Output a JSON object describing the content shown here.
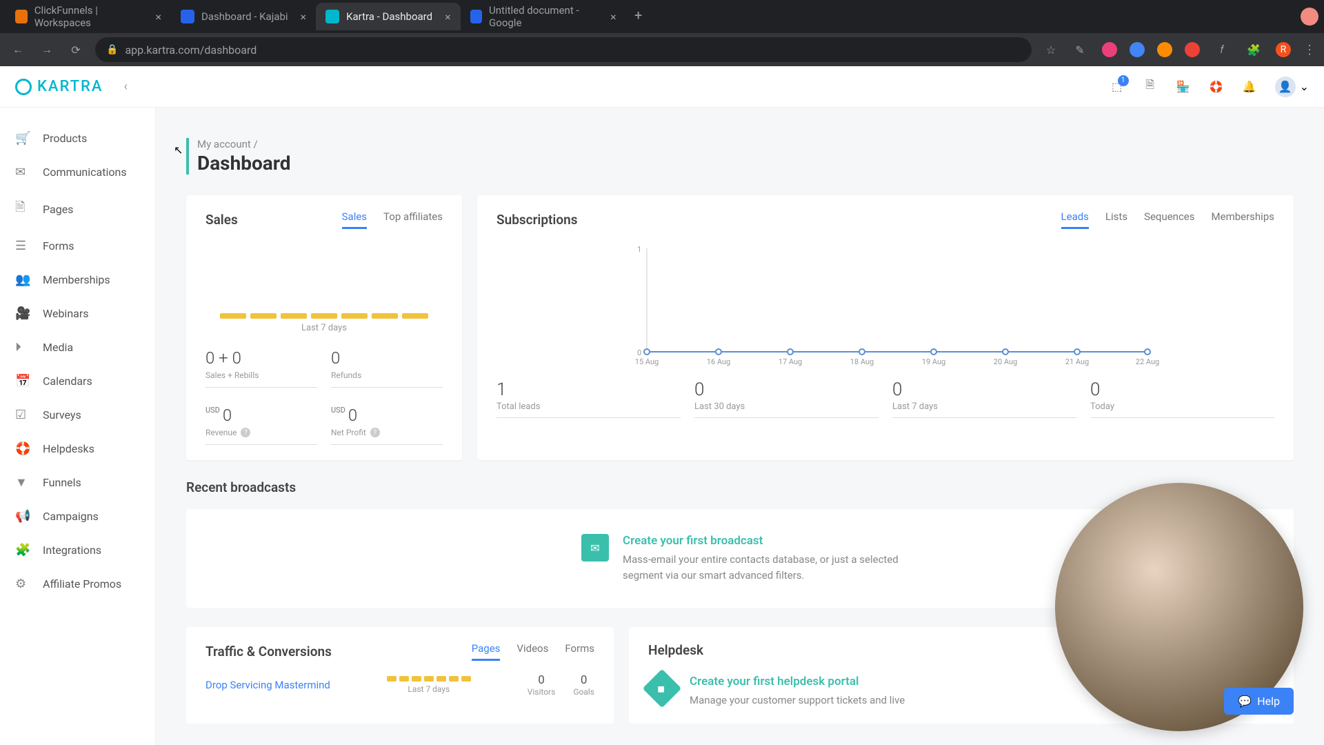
{
  "browser": {
    "tabs": [
      {
        "title": "ClickFunnels | Workspaces",
        "favBg": "#e8710a"
      },
      {
        "title": "Dashboard - Kajabi",
        "favBg": "#2563eb"
      },
      {
        "title": "Kartra - Dashboard",
        "favBg": "#00b7cd",
        "active": true
      },
      {
        "title": "Untitled document - Google",
        "favBg": "#2563eb"
      }
    ],
    "url": "app.kartra.com/dashboard"
  },
  "logo": "KARTRA",
  "nav": [
    {
      "icon": "🛒",
      "label": "Products"
    },
    {
      "icon": "✉",
      "label": "Communications"
    },
    {
      "icon": "🗎",
      "label": "Pages"
    },
    {
      "icon": "☰",
      "label": "Forms"
    },
    {
      "icon": "👥",
      "label": "Memberships"
    },
    {
      "icon": "🎥",
      "label": "Webinars"
    },
    {
      "icon": "⏵",
      "label": "Media"
    },
    {
      "icon": "📅",
      "label": "Calendars"
    },
    {
      "icon": "☑",
      "label": "Surveys"
    },
    {
      "icon": "🛟",
      "label": "Helpdesks"
    },
    {
      "icon": "▼",
      "label": "Funnels"
    },
    {
      "icon": "📢",
      "label": "Campaigns"
    },
    {
      "icon": "🧩",
      "label": "Integrations"
    },
    {
      "icon": "⚙",
      "label": "Affiliate Promos"
    }
  ],
  "breadcrumb": {
    "parent": "My account /",
    "title": "Dashboard"
  },
  "sales": {
    "title": "Sales",
    "tabs": [
      "Sales",
      "Top affiliates"
    ],
    "period": "Last 7 days",
    "stats": [
      {
        "value": "0 + 0",
        "label": "Sales + Rebills"
      },
      {
        "value": "0",
        "label": "Refunds"
      },
      {
        "currency": "USD",
        "value": "0",
        "label": "Revenue",
        "help": true
      },
      {
        "currency": "USD",
        "value": "0",
        "label": "Net Profit",
        "help": true
      }
    ]
  },
  "subs": {
    "title": "Subscriptions",
    "tabs": [
      "Leads",
      "Lists",
      "Sequences",
      "Memberships"
    ],
    "stats": [
      {
        "value": "1",
        "label": "Total leads"
      },
      {
        "value": "0",
        "label": "Last 30 days"
      },
      {
        "value": "0",
        "label": "Last 7 days"
      },
      {
        "value": "0",
        "label": "Today"
      }
    ]
  },
  "chart_data": {
    "type": "line",
    "categories": [
      "15 Aug",
      "16 Aug",
      "17 Aug",
      "18 Aug",
      "19 Aug",
      "20 Aug",
      "21 Aug",
      "22 Aug"
    ],
    "values": [
      0,
      0,
      0,
      0,
      0,
      0,
      0,
      0
    ],
    "ylim": [
      0,
      1
    ],
    "yticks": [
      0,
      1
    ],
    "title": "",
    "xlabel": "",
    "ylabel": ""
  },
  "broadcasts": {
    "title": "Recent broadcasts",
    "promoTitle": "Create your first broadcast",
    "promoDesc": "Mass-email your entire contacts database, or just a selected segment via our smart advanced filters."
  },
  "traffic": {
    "title": "Traffic & Conversions",
    "tabs": [
      "Pages",
      "Videos",
      "Forms"
    ],
    "link": "Drop Servicing Mastermind",
    "period": "Last 7 days",
    "ministats": [
      {
        "value": "0",
        "label": "Visitors"
      },
      {
        "value": "0",
        "label": "Goals"
      }
    ],
    "row2": [
      {
        "value": "0"
      },
      {
        "value": "0"
      }
    ]
  },
  "helpdesk": {
    "title": "Helpdesk",
    "promoTitle": "Create your first helpdesk portal",
    "promoDesc": "Manage your customer support tickets and live"
  },
  "help": "Help"
}
